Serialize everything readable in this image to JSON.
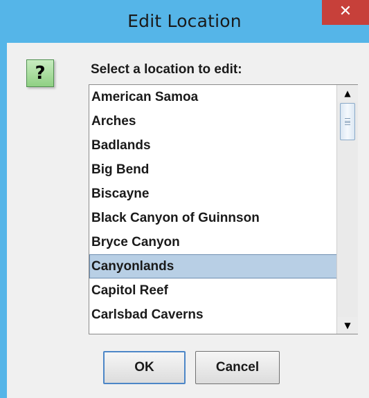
{
  "window": {
    "title": "Edit Location",
    "close_glyph": "✕"
  },
  "dialog": {
    "icon": "question-icon",
    "icon_glyph": "?",
    "prompt": "Select a location to edit:",
    "items": [
      "American Samoa",
      "Arches",
      "Badlands",
      "Big Bend",
      "Biscayne",
      "Black Canyon of Guinnson",
      "Bryce Canyon",
      "Canyonlands",
      "Capitol Reef",
      "Carlsbad Caverns"
    ],
    "selected": "Canyonlands",
    "scroll_up_glyph": "▲",
    "scroll_down_glyph": "▼"
  },
  "buttons": {
    "ok": "OK",
    "cancel": "Cancel"
  },
  "colors": {
    "titlebar": "#55b5e8",
    "close": "#c7403a",
    "selection": "#b8cfe5",
    "panel": "#f0f0f0"
  }
}
